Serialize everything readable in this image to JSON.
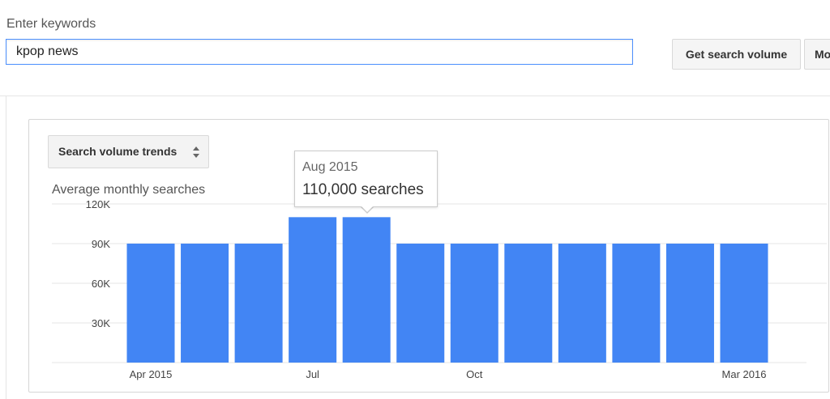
{
  "search": {
    "label": "Enter keywords",
    "value": "kpop news"
  },
  "buttons": {
    "get_search_volume": "Get search volume",
    "more": "Mo"
  },
  "panel": {
    "selector_label": "Search volume trends",
    "y_title": "Average monthly searches"
  },
  "tooltip": {
    "month": "Aug 2015",
    "value": "110,000 searches"
  },
  "colors": {
    "bar": "#4285f4",
    "grid": "#e6e6e6",
    "input_border": "#4d90fe"
  },
  "chart_data": {
    "type": "bar",
    "categories": [
      "Apr 2015",
      "May 2015",
      "Jun 2015",
      "Jul 2015",
      "Aug 2015",
      "Sep 2015",
      "Oct 2015",
      "Nov 2015",
      "Dec 2015",
      "Jan 2016",
      "Feb 2016",
      "Mar 2016"
    ],
    "values": [
      90000,
      90000,
      90000,
      110000,
      110000,
      90000,
      90000,
      90000,
      90000,
      90000,
      90000,
      90000
    ],
    "x_tick_labels": [
      "Apr 2015",
      "",
      "",
      "Jul",
      "",
      "",
      "Oct",
      "",
      "",
      "",
      "",
      "Mar 2016"
    ],
    "y_ticks": [
      30000,
      60000,
      90000,
      120000
    ],
    "y_tick_labels": [
      "30K",
      "60K",
      "90K",
      "120K"
    ],
    "ylim": [
      0,
      120000
    ],
    "ylabel": "Average monthly searches",
    "grid": true
  }
}
